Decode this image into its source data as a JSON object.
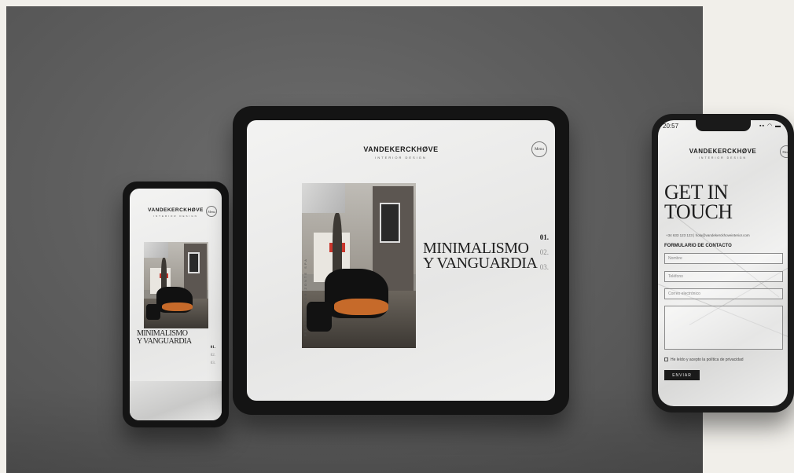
{
  "brand": {
    "name": "VANDEKERCKHØVE",
    "tagline": "INTERIOR DESIGN"
  },
  "menu_label": "Menu",
  "hero": {
    "line1": "MINIMALISMO",
    "line2": "Y VANGUARDIA",
    "vertical_caption": "PROYECTO HORIZONTE SPA",
    "slides": [
      "01.",
      "02.",
      "03."
    ],
    "active_slide": 0
  },
  "contact": {
    "status_time": "20:57",
    "status_icons": "▪▪ ◠ ▬",
    "headline_line1": "GET IN",
    "headline_line2": "TOUCH",
    "contact_line": "+34 633 123 123 | hola@vandekerckhoveinterior.com",
    "form_title": "FORMULARIO DE CONTACTO",
    "fields": {
      "name_placeholder": "Nombre",
      "phone_placeholder": "Teléfono",
      "email_placeholder": "Correo electrónico",
      "message_placeholder": ""
    },
    "privacy_label": "He leído y acepto la política de privacidad",
    "send_label": "ENVIAR"
  },
  "colors": {
    "background": "#f1efea",
    "stage": "#5f5f5f",
    "device_frame": "#141414",
    "accent_dark": "#1a1a1a"
  }
}
